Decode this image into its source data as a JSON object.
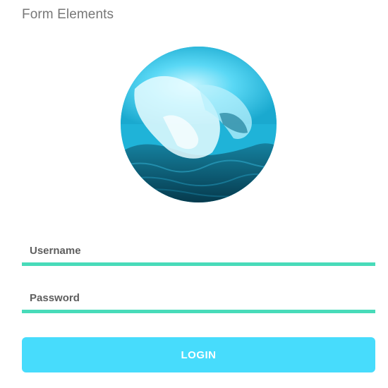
{
  "section": {
    "title": "Form Elements"
  },
  "avatar": {
    "description_icon": "ocean-wave-image",
    "tint": "#29c6ea"
  },
  "form": {
    "username": {
      "placeholder": "Username",
      "value": ""
    },
    "password": {
      "placeholder": "Password",
      "value": ""
    },
    "login_label": "LOGIN"
  },
  "colors": {
    "underline": "#48dbb9",
    "button": "#47dcfc",
    "title_text": "#777777"
  }
}
